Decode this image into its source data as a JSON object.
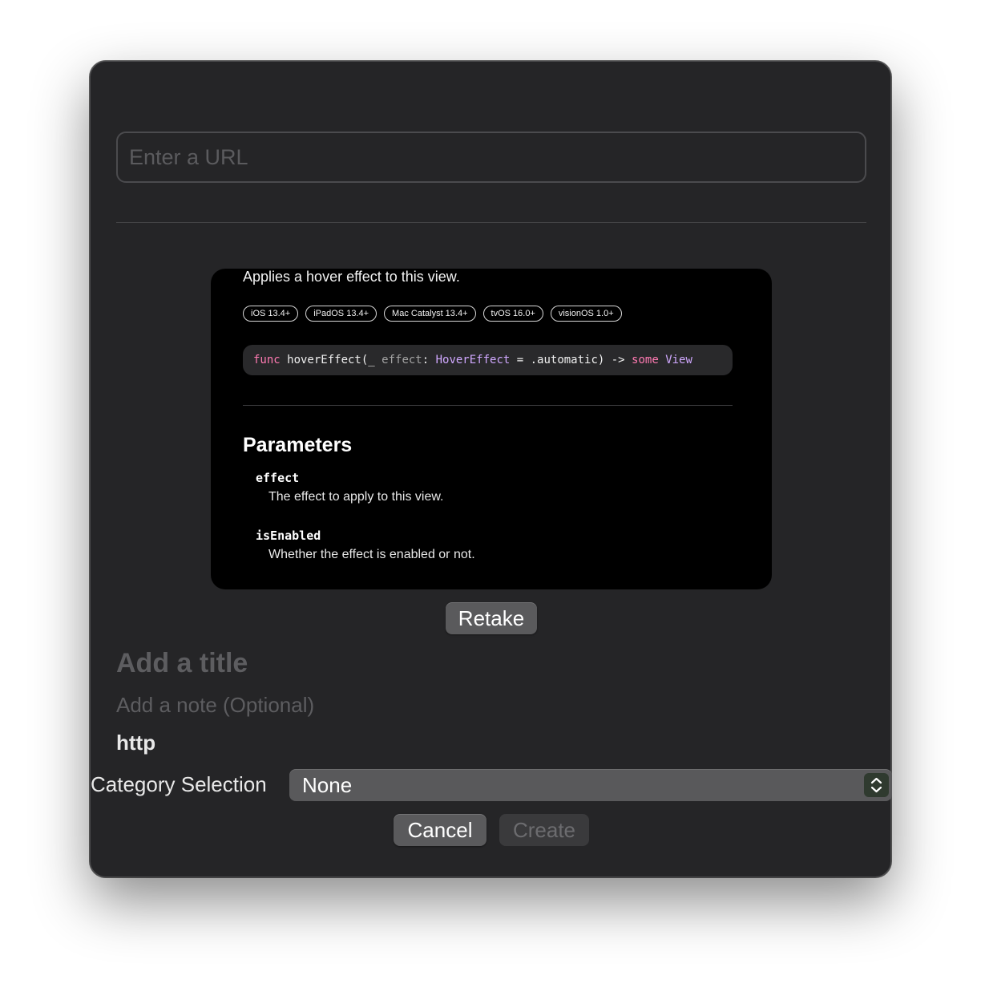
{
  "url_input": {
    "placeholder": "Enter a URL",
    "value": ""
  },
  "preview": {
    "summary": "Applies a hover effect to this view.",
    "badges": [
      "iOS 13.4+",
      "iPadOS 13.4+",
      "Mac Catalyst 13.4+",
      "tvOS 16.0+",
      "visionOS 1.0+"
    ],
    "declaration": {
      "kw_func": "func",
      "name": " hoverEffect(_ ",
      "param": "effect",
      "colon": ": ",
      "type": "HoverEffect",
      "default": " = .automatic) -> ",
      "kw_some": "some",
      "space": " ",
      "return_type": "View"
    },
    "parameters_heading": "Parameters",
    "parameters": [
      {
        "name": "effect",
        "description": "The effect to apply to this view."
      },
      {
        "name": "isEnabled",
        "description": "Whether the effect is enabled or not."
      }
    ]
  },
  "retake_label": "Retake",
  "title_input": {
    "placeholder": "Add a title",
    "value": ""
  },
  "note_input": {
    "placeholder": "Add a note (Optional)",
    "value": ""
  },
  "url_display": "http",
  "category": {
    "label": "Category Selection",
    "selected": "None"
  },
  "actions": {
    "cancel_label": "Cancel",
    "create_label": "Create"
  },
  "colors": {
    "window_bg": "#252527",
    "preview_bg": "#000000",
    "keyword": "#ff7ab2",
    "type": "#d0a8ff",
    "stepper_bg": "#2f3a2f"
  }
}
